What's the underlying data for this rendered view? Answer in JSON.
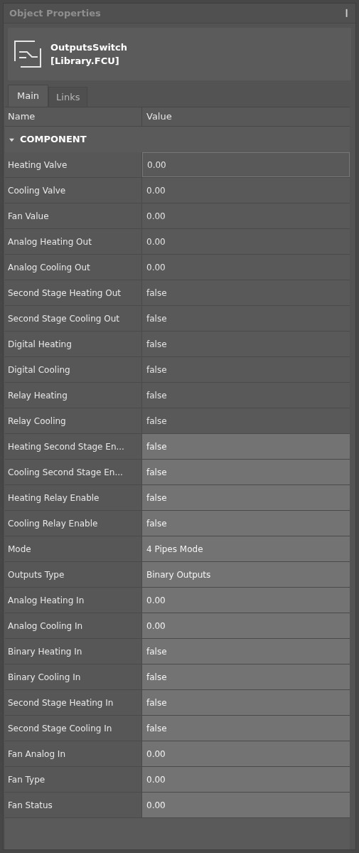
{
  "panel": {
    "title": "Object Properties",
    "pin": "❙"
  },
  "object": {
    "name": "OutputsSwitch",
    "library": "[Library.FCU]"
  },
  "tabs": [
    {
      "label": "Main",
      "selected": true
    },
    {
      "label": "Links",
      "selected": false
    }
  ],
  "table": {
    "columns": [
      "Name",
      "Value"
    ],
    "group": {
      "label": "COMPONENT",
      "expanded": true
    },
    "rows": [
      {
        "name": "Heating Valve",
        "value": "0.00",
        "readonly": true,
        "selected": true
      },
      {
        "name": "Cooling Valve",
        "value": "0.00",
        "readonly": true,
        "selected": false
      },
      {
        "name": "Fan Value",
        "value": "0.00",
        "readonly": true,
        "selected": false
      },
      {
        "name": "Analog Heating Out",
        "value": "0.00",
        "readonly": true,
        "selected": false
      },
      {
        "name": "Analog Cooling Out",
        "value": "0.00",
        "readonly": true,
        "selected": false
      },
      {
        "name": "Second Stage Heating Out",
        "value": "false",
        "readonly": true,
        "selected": false
      },
      {
        "name": "Second Stage Cooling Out",
        "value": "false",
        "readonly": true,
        "selected": false
      },
      {
        "name": "Digital Heating",
        "value": "false",
        "readonly": true,
        "selected": false
      },
      {
        "name": "Digital Cooling",
        "value": "false",
        "readonly": true,
        "selected": false
      },
      {
        "name": "Relay Heating",
        "value": "false",
        "readonly": true,
        "selected": false
      },
      {
        "name": "Relay Cooling",
        "value": "false",
        "readonly": true,
        "selected": false
      },
      {
        "name": "Heating Second Stage En...",
        "value": "false",
        "readonly": false,
        "selected": false
      },
      {
        "name": "Cooling Second Stage En...",
        "value": "false",
        "readonly": false,
        "selected": false
      },
      {
        "name": "Heating Relay Enable",
        "value": "false",
        "readonly": false,
        "selected": false
      },
      {
        "name": "Cooling Relay Enable",
        "value": "false",
        "readonly": false,
        "selected": false
      },
      {
        "name": "Mode",
        "value": "4 Pipes Mode",
        "readonly": false,
        "selected": false
      },
      {
        "name": "Outputs Type",
        "value": "Binary Outputs",
        "readonly": false,
        "selected": false
      },
      {
        "name": "Analog Heating In",
        "value": "0.00",
        "readonly": false,
        "selected": false
      },
      {
        "name": "Analog Cooling In",
        "value": "0.00",
        "readonly": false,
        "selected": false
      },
      {
        "name": "Binary Heating In",
        "value": "false",
        "readonly": false,
        "selected": false
      },
      {
        "name": "Binary Cooling In",
        "value": "false",
        "readonly": false,
        "selected": false
      },
      {
        "name": "Second Stage Heating In",
        "value": "false",
        "readonly": false,
        "selected": false
      },
      {
        "name": "Second Stage Cooling In",
        "value": "false",
        "readonly": false,
        "selected": false
      },
      {
        "name": "Fan Analog In",
        "value": "0.00",
        "readonly": false,
        "selected": false
      },
      {
        "name": "Fan Type",
        "value": "0.00",
        "readonly": false,
        "selected": false
      },
      {
        "name": "Fan Status",
        "value": "0.00",
        "readonly": false,
        "selected": false
      }
    ]
  }
}
